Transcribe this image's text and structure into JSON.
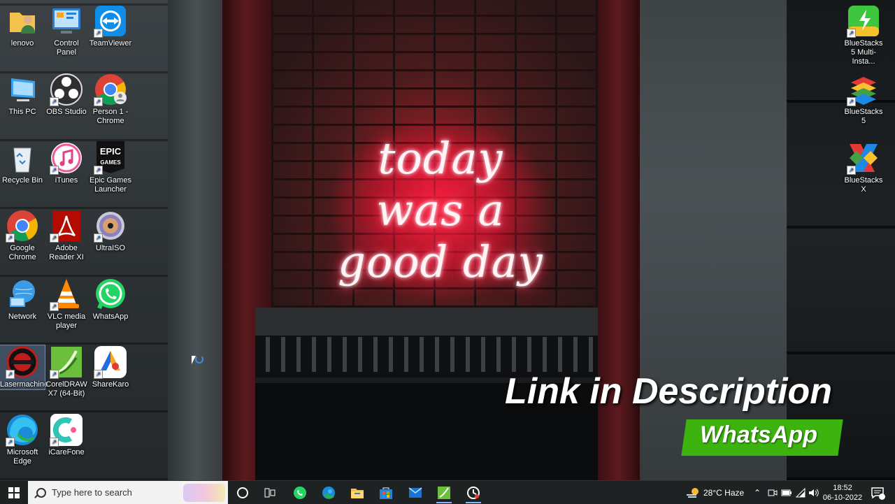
{
  "desktop_icons": [
    {
      "id": "lenovo",
      "label": "lenovo",
      "icon": "folder-user-icon"
    },
    {
      "id": "control-panel",
      "label": "Control Panel",
      "icon": "control-panel-icon"
    },
    {
      "id": "teamviewer",
      "label": "TeamViewer",
      "icon": "teamviewer-icon"
    },
    {
      "id": "this-pc",
      "label": "This PC",
      "icon": "computer-icon"
    },
    {
      "id": "obs",
      "label": "OBS Studio",
      "icon": "obs-icon"
    },
    {
      "id": "chrome-person",
      "label": "Person 1 - Chrome",
      "icon": "chrome-icon"
    },
    {
      "id": "recycle-bin",
      "label": "Recycle Bin",
      "icon": "recycle-bin-icon"
    },
    {
      "id": "itunes",
      "label": "iTunes",
      "icon": "itunes-icon"
    },
    {
      "id": "epic",
      "label": "Epic Games Launcher",
      "icon": "epic-games-icon",
      "logo": "EPIC GAMES"
    },
    {
      "id": "google-chrome",
      "label": "Google Chrome",
      "icon": "chrome-icon"
    },
    {
      "id": "adobe-reader",
      "label": "Adobe Reader XI",
      "icon": "adobe-reader-icon"
    },
    {
      "id": "ultraiso",
      "label": "UltraISO",
      "icon": "disc-icon"
    },
    {
      "id": "network",
      "label": "Network",
      "icon": "network-icon"
    },
    {
      "id": "vlc",
      "label": "VLC media player",
      "icon": "vlc-icon"
    },
    {
      "id": "whatsapp",
      "label": "WhatsApp",
      "icon": "whatsapp-icon"
    },
    {
      "id": "lasermachine",
      "label": "Lasermachine",
      "icon": "laser-icon"
    },
    {
      "id": "coreldraw",
      "label": "CorelDRAW X7 (64-Bit)",
      "icon": "coreldraw-icon"
    },
    {
      "id": "sharekaro",
      "label": "ShareKaro",
      "icon": "sharekaro-icon"
    },
    {
      "id": "edge",
      "label": "Microsoft Edge",
      "icon": "edge-icon"
    },
    {
      "id": "icarefone",
      "label": "iCareFone",
      "icon": "icarefone-icon"
    },
    {
      "id": "bluestacks-multi",
      "label": "BlueStacks 5 Multi-Insta...",
      "icon": "bluestacks-multi-icon"
    },
    {
      "id": "bluestacks5",
      "label": "BlueStacks 5",
      "icon": "bluestacks-icon"
    },
    {
      "id": "bluestacksx",
      "label": "BlueStacks X",
      "icon": "bluestacks-x-icon"
    }
  ],
  "wallpaper": {
    "neon_text": "today was a good day"
  },
  "overlay": {
    "title": "Link in Description",
    "badge": "WhatsApp",
    "badge_color": "#3cb30f"
  },
  "taskbar": {
    "search_placeholder": "Type here to search",
    "pinned": [
      "start-icon",
      "cortana-icon",
      "task-view-icon",
      "whatsapp-icon",
      "edge-icon",
      "file-explorer-icon",
      "microsoft-store-icon",
      "mail-icon",
      "coreldraw-icon",
      "screen-recorder-icon"
    ],
    "weather": "28°C  Haze",
    "time": "18:52",
    "date": "06-10-2022",
    "accent": "#0078d4"
  }
}
